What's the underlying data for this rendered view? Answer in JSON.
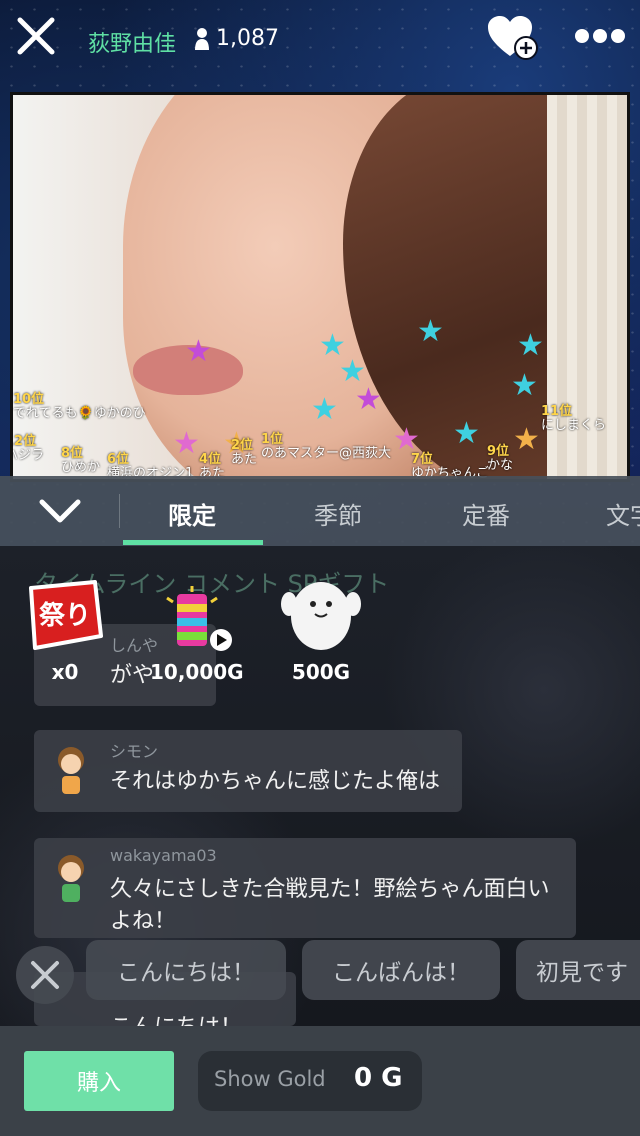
{
  "header": {
    "host_name": "荻野由佳",
    "viewer_count": "1,087"
  },
  "video": {
    "rank_tags": [
      {
        "rank": "10位",
        "name": "でれてるも🌻ゆかのひ"
      },
      {
        "rank": "11位",
        "name": "にしまくら"
      },
      {
        "rank": "12位",
        "name": "ハジラ"
      },
      {
        "rank": "8位",
        "name": "ひめか"
      },
      {
        "rank": "6位",
        "name": "横浜のオジン1"
      },
      {
        "rank": "4位",
        "name": "あた"
      },
      {
        "rank": "2位",
        "name": "あた"
      },
      {
        "rank": "1位",
        "name": "のあマスター@西荻大"
      },
      {
        "rank": "9位",
        "name": "かな"
      },
      {
        "rank": "7位",
        "name": "ゆかちゃんご"
      }
    ]
  },
  "tabs": {
    "items": [
      "限定",
      "季節",
      "定番",
      "文字"
    ],
    "active_index": 0
  },
  "faded_tabs": "タイムライン  コメント  SPギフト",
  "gifts": [
    {
      "name": "祭りだ!",
      "price": "x0"
    },
    {
      "name": "レインボー花火",
      "price": "10,000G"
    },
    {
      "name": "白いキャラ",
      "price": "500G"
    }
  ],
  "comments": [
    {
      "user": "しんや",
      "message": "がや"
    },
    {
      "user": "シモン",
      "message": "それはゆかちゃんに感じたよ俺は"
    },
    {
      "user": "wakayama03",
      "message": "久々にさしきた合戦見た！野絵ちゃん面白い",
      "message2": "よね！"
    },
    {
      "user": "",
      "message": "こんにちは！"
    }
  ],
  "quick_phrases": [
    "こんにちは！",
    "こんばんは！",
    "初見です"
  ],
  "bottom": {
    "buy_label": "購入",
    "gold_label": "Show Gold",
    "gold_value": "0 G"
  },
  "colors": {
    "accent": "#5fe0a4",
    "buy": "#6fe0a8"
  }
}
